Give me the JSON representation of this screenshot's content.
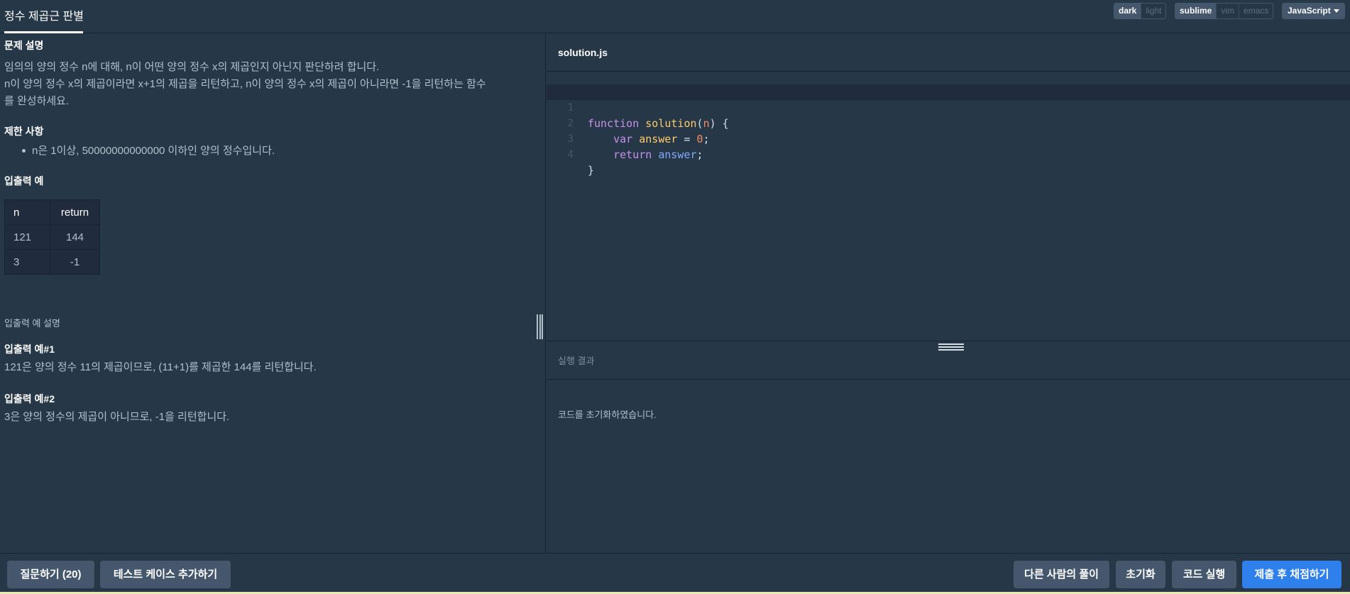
{
  "header": {
    "tab_title": "정수 제곱근 판별",
    "theme": {
      "dark": "dark",
      "light": "light"
    },
    "keymap": {
      "sublime": "sublime",
      "vim": "vim",
      "emacs": "emacs"
    },
    "language": "JavaScript"
  },
  "description": {
    "problem_heading": "문제 설명",
    "problem_lines": [
      "임의의 양의 정수 n에 대해, n이 어떤 양의 정수 x의 제곱인지 아닌지 판단하려 합니다.",
      "n이 양의 정수 x의 제곱이라면 x+1의 제곱을 리턴하고, n이 양의 정수 x의 제곱이 아니라면 -1을 리턴하는 함수",
      "를 완성하세요."
    ],
    "constraints_heading": "제한 사항",
    "constraints": [
      "n은 1이상, 50000000000000 이하인 양의 정수입니다."
    ],
    "examples_heading": "입출력 예",
    "table": {
      "headers": [
        "n",
        "return"
      ],
      "rows": [
        [
          "121",
          "144"
        ],
        [
          "3",
          "-1"
        ]
      ]
    },
    "explain_heading": "입출력 예 설명",
    "ex1_heading": "입출력 예#1",
    "ex1_text": "121은 양의 정수 11의 제곱이므로, (11+1)를 제곱한 144를 리턴합니다.",
    "ex2_heading": "입출력 예#2",
    "ex2_text": "3은 양의 정수의 제곱이 아니므로, -1을 리턴합니다."
  },
  "editor": {
    "filename": "solution.js",
    "lines": [
      {
        "num": "1",
        "t": [
          "function",
          "solution",
          "(",
          "n",
          ") {"
        ]
      },
      {
        "num": "2",
        "t": [
          "var",
          "answer",
          " = ",
          "0",
          ";"
        ]
      },
      {
        "num": "3",
        "t": [
          "return",
          "answer",
          ";"
        ]
      },
      {
        "num": "4",
        "t": [
          "}"
        ]
      }
    ]
  },
  "result": {
    "label": "실행 결과",
    "message": "코드를 초기화하였습니다."
  },
  "footer": {
    "ask": "질문하기 (20)",
    "add_test": "테스트 케이스 추가하기",
    "others": "다른 사람의 풀이",
    "reset": "초기화",
    "run": "코드 실행",
    "submit": "제출 후 채점하기"
  },
  "colors": {
    "accent": "#2f80ed",
    "background": "#263747",
    "button": "#44576c"
  }
}
